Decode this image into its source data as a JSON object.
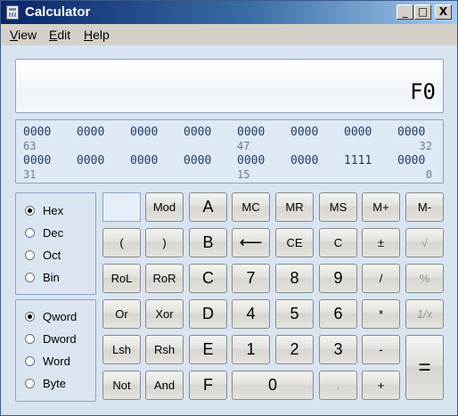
{
  "window": {
    "title": "Calculator",
    "min_glyph": "_",
    "max_glyph": "□",
    "close_glyph": "X"
  },
  "menu": {
    "view": "View",
    "view_key": "V",
    "view_rest": "iew",
    "edit": "Edit",
    "edit_key": "E",
    "edit_rest": "dit",
    "help": "Help",
    "help_key": "H",
    "help_rest": "elp"
  },
  "display": {
    "value": "F0"
  },
  "bits": {
    "row1": [
      "0000",
      "0000",
      "0000",
      "0000",
      "0000",
      "0000",
      "0000",
      "0000"
    ],
    "row1_pos": [
      "63",
      "47",
      "32"
    ],
    "row2": [
      "0000",
      "0000",
      "0000",
      "0000",
      "0000",
      "0000",
      "1111",
      "0000"
    ],
    "row2_pos": [
      "31",
      "15",
      "0"
    ]
  },
  "base": {
    "options": [
      "Hex",
      "Dec",
      "Oct",
      "Bin"
    ],
    "selected": "Hex"
  },
  "word": {
    "options": [
      "Qword",
      "Dword",
      "Word",
      "Byte"
    ],
    "selected": "Qword"
  },
  "keys": {
    "mod": "Mod",
    "a": "A",
    "mc": "MC",
    "mr": "MR",
    "ms": "MS",
    "mplus": "M+",
    "mminus": "M-",
    "lparen": "(",
    "rparen": ")",
    "b": "B",
    "back": "⟵",
    "ce": "CE",
    "c": "C",
    "plusminus": "±",
    "sqrt": "√",
    "rol": "RoL",
    "ror": "RoR",
    "cc": "C",
    "seven": "7",
    "eight": "8",
    "nine": "9",
    "div": "/",
    "pct": "%",
    "or": "Or",
    "xor": "Xor",
    "d": "D",
    "four": "4",
    "five": "5",
    "six": "6",
    "mul": "*",
    "recip": "1/x",
    "lsh": "Lsh",
    "rsh": "Rsh",
    "e": "E",
    "one": "1",
    "two": "2",
    "three": "3",
    "minus": "-",
    "equals": "=",
    "not": "Not",
    "and": "And",
    "f": "F",
    "zero": "0",
    "dot": ".",
    "plus": "+"
  }
}
